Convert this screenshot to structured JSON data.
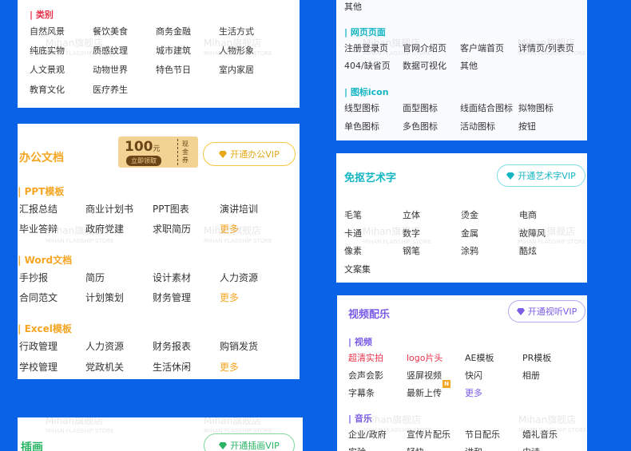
{
  "categories_card": {
    "section_title": "类别",
    "items": [
      "自然风景",
      "餐饮美食",
      "商务金融",
      "生活方式",
      "纯底实物",
      "质感纹理",
      "城市建筑",
      "人物形象",
      "人文景观",
      "动物世界",
      "特色节日",
      "室内家居",
      "教育文化",
      "医疗养生"
    ]
  },
  "office_card": {
    "title": "办公文档",
    "coupon_amount": "100",
    "coupon_unit": "元",
    "coupon_action": "立即领取",
    "coupon_tag": "现金券",
    "vip_label": "开通办公VIP",
    "sections": [
      {
        "title": "PPT模板",
        "items": [
          "汇报总结",
          "商业计划书",
          "PPT图表",
          "演讲培训",
          "毕业答辩",
          "政府党建",
          "求职简历"
        ],
        "more": "更多"
      },
      {
        "title": "Word文档",
        "items": [
          "手抄报",
          "简历",
          "设计素材",
          "人力资源",
          "合同范文",
          "计划策划",
          "财务管理"
        ],
        "more": "更多"
      },
      {
        "title": "Excel模板",
        "items": [
          "行政管理",
          "人力资源",
          "财务报表",
          "购销发货",
          "学校管理",
          "党政机关",
          "生活休闲"
        ],
        "more": "更多"
      }
    ]
  },
  "illustration_card": {
    "title": "插画",
    "vip_label": "开通插画VIP"
  },
  "ui_card": {
    "top_item": "其他",
    "web_section": {
      "title": "网页页面",
      "items": [
        "注册登录页",
        "官网介绍页",
        "客户端首页",
        "详情页/列表页",
        "404/缺省页",
        "数据可视化",
        "其他"
      ]
    },
    "icon_section": {
      "title": "图标icon",
      "items": [
        "线型图标",
        "面型图标",
        "线面结合图标",
        "拟物图标",
        "单色图标",
        "多色图标",
        "活动图标",
        "按钮"
      ]
    }
  },
  "art_card": {
    "title": "免抠艺术字",
    "vip_label": "开通艺术字VIP",
    "items": [
      "毛笔",
      "立体",
      "烫金",
      "电商",
      "卡通",
      "数字",
      "金属",
      "故障风",
      "像素",
      "钢笔",
      "涂鸦",
      "酷炫",
      "文案集"
    ]
  },
  "video_card": {
    "title": "视频配乐",
    "vip_label": "开通视听VIP",
    "video_section": {
      "title": "视频",
      "items": [
        "超清实拍",
        "logo片头",
        "AE模板",
        "PR模板",
        "会声会影",
        "竖屏视频",
        "快闪",
        "相册",
        "字幕条",
        "最新上传"
      ],
      "more": "更多",
      "new_badge": "N"
    },
    "music_section": {
      "title": "音乐",
      "items": [
        "企业/政府",
        "宣传片配乐",
        "节日配乐",
        "婚礼音乐",
        "实验",
        "轻快",
        "讲和",
        "史诗"
      ]
    }
  },
  "watermark": {
    "name": "Mihan旗舰店",
    "sub": "MIHAN FLAGSHIP STORE"
  },
  "colors": {
    "blue": "#0a63e6",
    "red": "#e8334a",
    "orange": "#f5a623",
    "gold": "#e6a817",
    "teal": "#13b5c2",
    "purple": "#7a5ce6",
    "green": "#28b463",
    "title_blue": "#1d62d8"
  }
}
